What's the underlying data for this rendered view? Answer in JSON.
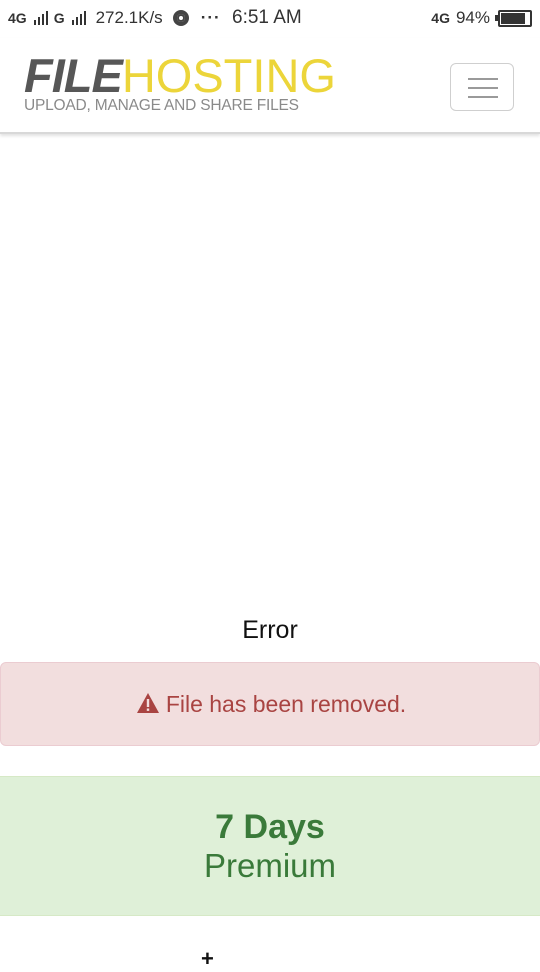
{
  "status_bar": {
    "network_1": "4G",
    "network_2": "G",
    "speed": "272.1K/s",
    "dots": "···",
    "time": "6:51 AM",
    "network_right": "4G",
    "battery_text": "94%",
    "battery_level": 0.94
  },
  "header": {
    "logo_file": "FILE",
    "logo_hosting": "HOSTING",
    "logo_tagline": "UPLOAD, MANAGE AND SHARE FILES"
  },
  "content": {
    "error_title": "Error",
    "alert_message": "File has been removed.",
    "premium_days": "7 Days",
    "premium_label": "Premium",
    "bottom_symbol": "+"
  },
  "colors": {
    "alert_bg": "#f2dede",
    "alert_text": "#a94442",
    "premium_bg": "#dff0d8",
    "premium_text": "#3a7a3a",
    "logo_gray": "#575757",
    "logo_yellow": "#ecd53a"
  }
}
